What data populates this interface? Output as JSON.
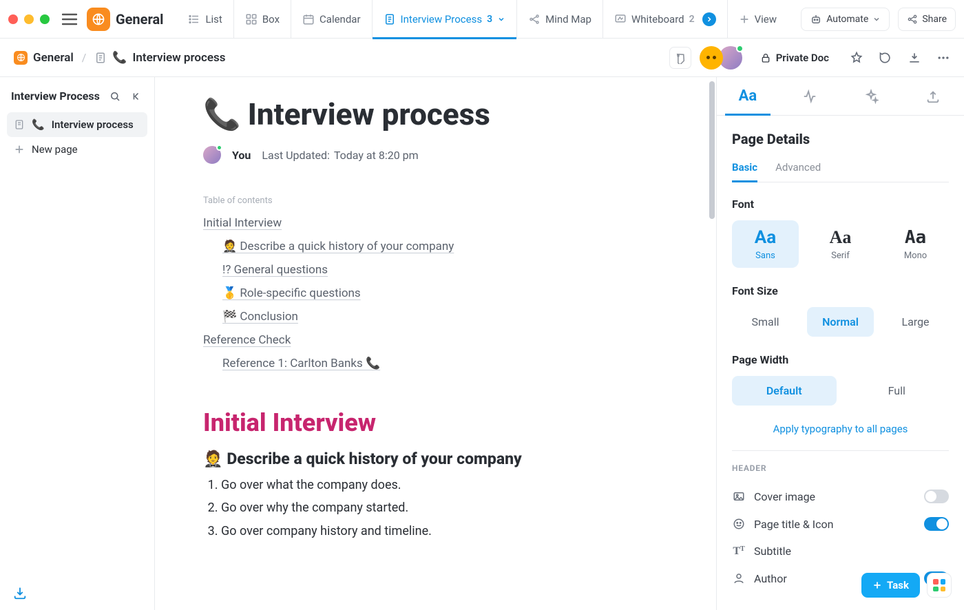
{
  "space": {
    "name": "General"
  },
  "views": [
    {
      "key": "list",
      "label": "List"
    },
    {
      "key": "box",
      "label": "Box"
    },
    {
      "key": "calendar",
      "label": "Calendar"
    },
    {
      "key": "interview",
      "label": "Interview Process",
      "count": "3",
      "active": true
    },
    {
      "key": "mindmap",
      "label": "Mind Map"
    },
    {
      "key": "whiteboard",
      "label": "Whiteboard",
      "count": "2",
      "overflow": true
    },
    {
      "key": "view",
      "label": "View"
    }
  ],
  "topbar": {
    "automate": "Automate",
    "share": "Share"
  },
  "breadcrumb": {
    "space": "General",
    "page": "Interview process"
  },
  "privacy": "Private Doc",
  "sidebar": {
    "title": "Interview Process",
    "items": [
      {
        "label": "Interview process",
        "active": true
      },
      {
        "label": "New page",
        "new": true
      }
    ]
  },
  "doc": {
    "emoji": "📞",
    "title": "Interview process",
    "author_label": "You",
    "updated_label": "Last Updated:",
    "updated_value": "Today at 8:20 pm",
    "toc_label": "Table of contents",
    "toc": [
      {
        "lvl": 1,
        "text": "Initial Interview"
      },
      {
        "lvl": 2,
        "text": "🤵 Describe a quick history of your company"
      },
      {
        "lvl": 2,
        "text": "!? General questions"
      },
      {
        "lvl": 2,
        "text": "🥇 Role-specific questions"
      },
      {
        "lvl": 2,
        "text": "🏁 Conclusion"
      },
      {
        "lvl": 1,
        "text": "Reference Check"
      },
      {
        "lvl": 2,
        "text": "Reference 1: Carlton Banks 📞"
      }
    ],
    "section_heading": "Initial Interview",
    "subsection_heading": "🤵 Describe a quick history of your company",
    "body_list": [
      "Go over what the company does.",
      "Go over why the company started.",
      "Go over company history and timeline."
    ]
  },
  "right": {
    "title": "Page Details",
    "subtabs": {
      "basic": "Basic",
      "advanced": "Advanced"
    },
    "font_label": "Font",
    "fonts": {
      "sans": "Sans",
      "serif": "Serif",
      "mono": "Mono",
      "sample": "Aa"
    },
    "fontsize_label": "Font Size",
    "sizes": {
      "small": "Small",
      "normal": "Normal",
      "large": "Large"
    },
    "width_label": "Page Width",
    "widths": {
      "default": "Default",
      "full": "Full"
    },
    "apply_link": "Apply typography to all pages",
    "header_label": "HEADER",
    "header_opts": {
      "cover": "Cover image",
      "title_icon": "Page title & Icon",
      "subtitle": "Subtitle",
      "author": "Author"
    }
  },
  "fab": {
    "task": "Task"
  }
}
